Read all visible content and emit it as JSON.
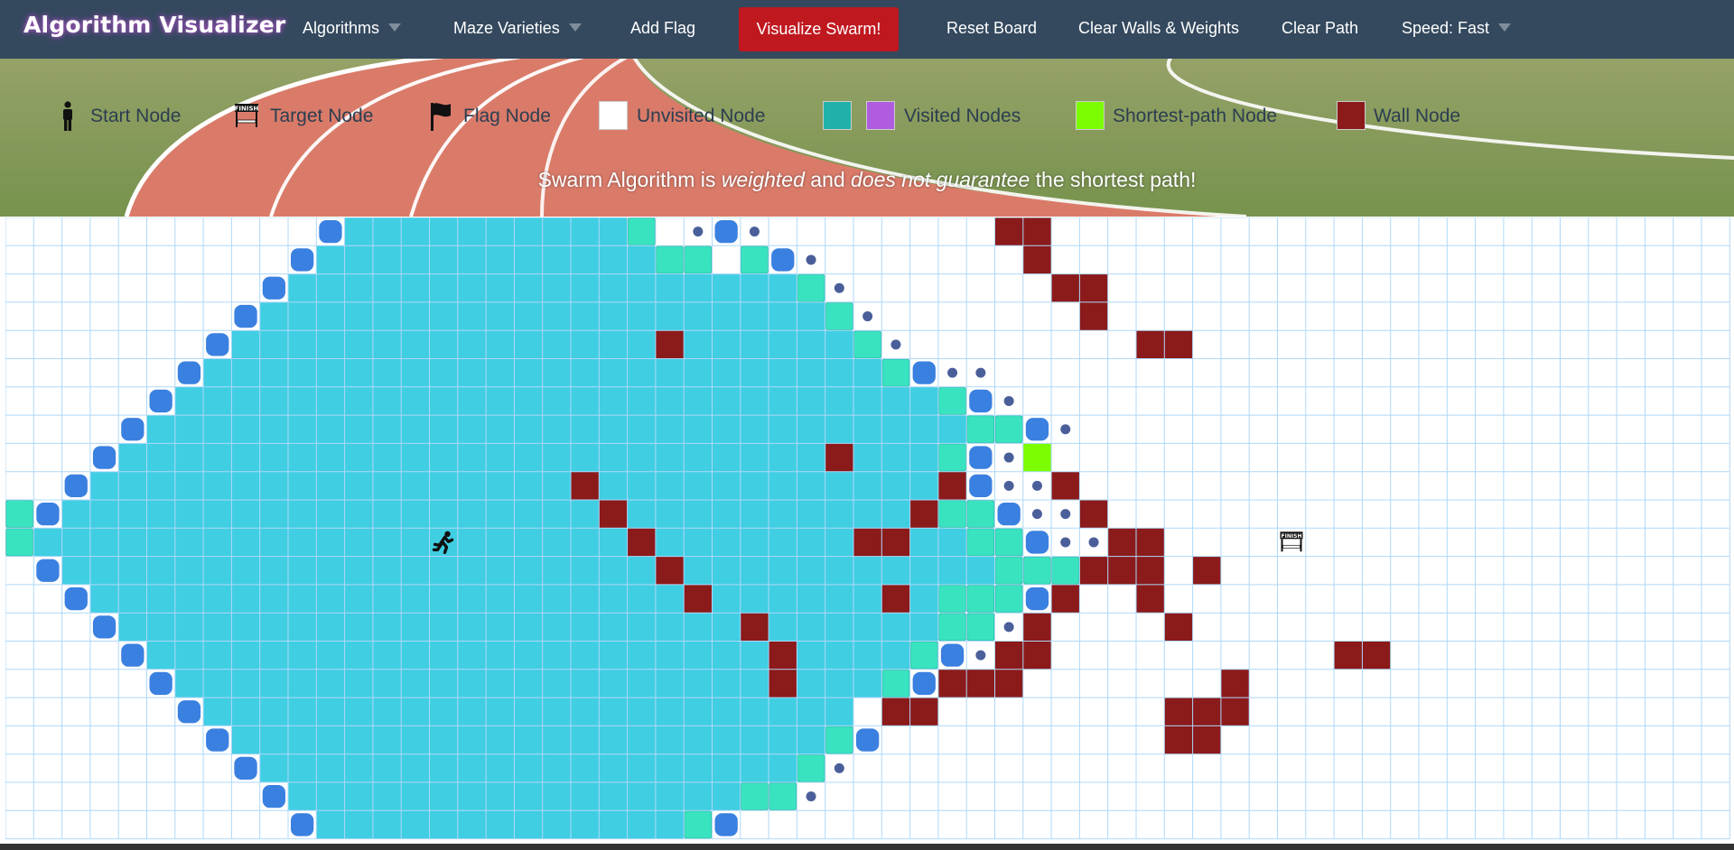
{
  "app": {
    "title": "Algorithm Visualizer"
  },
  "nav": {
    "algorithms": "Algorithms",
    "maze": "Maze Varieties",
    "add_flag": "Add Flag",
    "visualize": "Visualize Swarm!",
    "reset": "Reset Board",
    "clear_walls": "Clear Walls & Weights",
    "clear_path": "Clear Path",
    "speed": "Speed: Fast"
  },
  "legend": {
    "start": "Start Node",
    "target": "Target Node",
    "flag": "Flag Node",
    "unvisited": "Unvisited Node",
    "visited": "Visited Nodes",
    "shortest": "Shortest-path Node",
    "wall": "Wall Node"
  },
  "note": {
    "part1": "Swarm Algorithm is",
    "weighted": "weighted",
    "part2": "and",
    "no_guarantee": "does not guarantee",
    "part3": "the shortest path!"
  },
  "target_icon_text": "FINISH",
  "colors": {
    "nav": "#34495e",
    "visualize": "#c0181f",
    "visited": "#40cee3",
    "visited_alt": "#b05ce0",
    "visited_swatch": "#20b2aa",
    "frontier": "#3a80e0",
    "frontier_dot": "#4a5f9a",
    "recent": "#39e3c0",
    "shortest": "#7cfc00",
    "wall": "#8b1a1a",
    "grid_line": "#afd8f8"
  },
  "grid": {
    "rows": 22,
    "cols": 61,
    "start": [
      11,
      15
    ],
    "target": [
      11,
      45
    ],
    "walls": [
      [
        0,
        35
      ],
      [
        0,
        36
      ],
      [
        1,
        36
      ],
      [
        2,
        37
      ],
      [
        2,
        38
      ],
      [
        3,
        38
      ],
      [
        4,
        23
      ],
      [
        4,
        40
      ],
      [
        4,
        41
      ],
      [
        8,
        29
      ],
      [
        9,
        20
      ],
      [
        9,
        33
      ],
      [
        9,
        37
      ],
      [
        10,
        21
      ],
      [
        10,
        32
      ],
      [
        10,
        38
      ],
      [
        11,
        22
      ],
      [
        11,
        30
      ],
      [
        11,
        31
      ],
      [
        11,
        39
      ],
      [
        11,
        40
      ],
      [
        12,
        23
      ],
      [
        12,
        38
      ],
      [
        12,
        39
      ],
      [
        12,
        40
      ],
      [
        12,
        42
      ],
      [
        13,
        24
      ],
      [
        13,
        31
      ],
      [
        13,
        37
      ],
      [
        13,
        40
      ],
      [
        14,
        26
      ],
      [
        14,
        36
      ],
      [
        14,
        41
      ],
      [
        15,
        27
      ],
      [
        15,
        35
      ],
      [
        15,
        36
      ],
      [
        15,
        47
      ],
      [
        15,
        48
      ],
      [
        16,
        27
      ],
      [
        16,
        33
      ],
      [
        16,
        34
      ],
      [
        16,
        35
      ],
      [
        16,
        43
      ],
      [
        17,
        31
      ],
      [
        17,
        32
      ],
      [
        17,
        41
      ],
      [
        17,
        42
      ],
      [
        17,
        43
      ],
      [
        18,
        41
      ],
      [
        18,
        42
      ]
    ],
    "visited_rows": [
      [
        0,
        12,
        21
      ],
      [
        1,
        11,
        22
      ],
      [
        2,
        10,
        27
      ],
      [
        3,
        9,
        28
      ],
      [
        4,
        8,
        29
      ],
      [
        5,
        7,
        30
      ],
      [
        6,
        6,
        32
      ],
      [
        7,
        5,
        33
      ],
      [
        8,
        4,
        33
      ],
      [
        9,
        3,
        33
      ],
      [
        10,
        2,
        33
      ],
      [
        11,
        1,
        33
      ],
      [
        12,
        2,
        34
      ],
      [
        13,
        3,
        33
      ],
      [
        14,
        4,
        32
      ],
      [
        15,
        5,
        31
      ],
      [
        16,
        6,
        30
      ],
      [
        17,
        7,
        29
      ],
      [
        18,
        8,
        28
      ],
      [
        19,
        9,
        27
      ],
      [
        20,
        10,
        26
      ],
      [
        21,
        11,
        24
      ]
    ],
    "recent": [
      [
        0,
        22
      ],
      [
        1,
        23
      ],
      [
        1,
        24
      ],
      [
        1,
        26
      ],
      [
        2,
        28
      ],
      [
        3,
        29
      ],
      [
        4,
        30
      ],
      [
        5,
        31
      ],
      [
        6,
        33
      ],
      [
        7,
        34
      ],
      [
        7,
        35
      ],
      [
        8,
        33
      ],
      [
        10,
        33
      ],
      [
        10,
        34
      ],
      [
        11,
        34
      ],
      [
        11,
        35
      ],
      [
        12,
        35
      ],
      [
        12,
        36
      ],
      [
        12,
        37
      ],
      [
        13,
        33
      ],
      [
        13,
        34
      ],
      [
        13,
        35
      ],
      [
        14,
        33
      ],
      [
        14,
        34
      ],
      [
        15,
        32
      ],
      [
        16,
        31
      ],
      [
        18,
        29
      ],
      [
        19,
        28
      ],
      [
        20,
        26
      ],
      [
        20,
        27
      ],
      [
        21,
        24
      ],
      [
        10,
        0
      ],
      [
        11,
        0
      ],
      [
        12,
        1
      ]
    ],
    "frontier": [
      [
        0,
        11
      ],
      [
        0,
        25
      ],
      [
        1,
        10
      ],
      [
        1,
        27
      ],
      [
        2,
        9
      ],
      [
        3,
        8
      ],
      [
        4,
        7
      ],
      [
        5,
        6
      ],
      [
        5,
        32
      ],
      [
        6,
        5
      ],
      [
        6,
        34
      ],
      [
        7,
        4
      ],
      [
        7,
        36
      ],
      [
        8,
        3
      ],
      [
        8,
        34
      ],
      [
        9,
        2
      ],
      [
        9,
        34
      ],
      [
        10,
        1
      ],
      [
        10,
        35
      ],
      [
        11,
        36
      ],
      [
        12,
        1
      ],
      [
        13,
        2
      ],
      [
        13,
        36
      ],
      [
        14,
        3
      ],
      [
        14,
        35
      ],
      [
        15,
        4
      ],
      [
        15,
        33
      ],
      [
        16,
        5
      ],
      [
        16,
        32
      ],
      [
        17,
        6
      ],
      [
        18,
        7
      ],
      [
        18,
        30
      ],
      [
        19,
        8
      ],
      [
        20,
        9
      ],
      [
        21,
        10
      ],
      [
        21,
        25
      ]
    ],
    "dots": [
      [
        0,
        24
      ],
      [
        0,
        26
      ],
      [
        1,
        28
      ],
      [
        2,
        29
      ],
      [
        3,
        30
      ],
      [
        4,
        31
      ],
      [
        5,
        33
      ],
      [
        5,
        34
      ],
      [
        6,
        35
      ],
      [
        7,
        37
      ],
      [
        8,
        35
      ],
      [
        9,
        35
      ],
      [
        9,
        36
      ],
      [
        10,
        36
      ],
      [
        10,
        37
      ],
      [
        11,
        37
      ],
      [
        11,
        38
      ],
      [
        14,
        35
      ],
      [
        15,
        34
      ],
      [
        17,
        32
      ],
      [
        19,
        29
      ],
      [
        20,
        28
      ]
    ],
    "shortest": [
      [
        8,
        36
      ]
    ]
  }
}
